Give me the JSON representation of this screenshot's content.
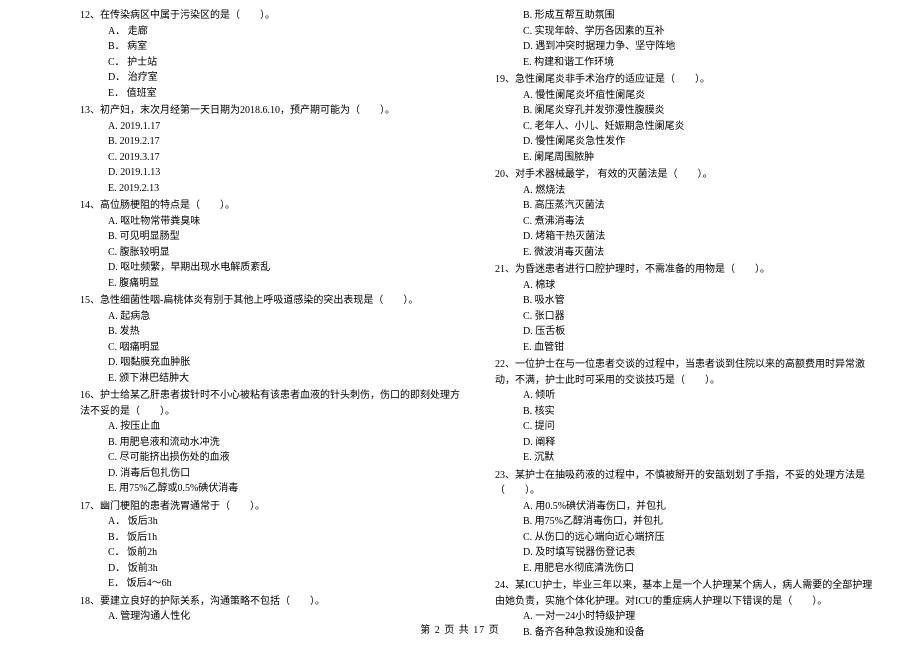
{
  "footer": "第 2 页 共 17 页",
  "left": [
    {
      "num": "12",
      "stem": "12、在传染病区中属于污染区的是（　　）。",
      "opts": [
        "A． 走廊",
        "B． 病室",
        "C． 护士站",
        "D． 治疗室",
        "E． 值班室"
      ]
    },
    {
      "num": "13",
      "stem": "13、初产妇，末次月经第一天日期为2018.6.10，预产期可能为（　　）。",
      "opts": [
        "A. 2019.1.17",
        "B. 2019.2.17",
        "C. 2019.3.17",
        "D. 2019.1.13",
        "E. 2019.2.13"
      ]
    },
    {
      "num": "14",
      "stem": "14、高位肠梗阻的特点是（　　）。",
      "opts": [
        "A. 呕吐物常带粪臭味",
        "B. 可见明显肠型",
        "C. 腹胀较明显",
        "D. 呕吐频繁，早期出现水电解质紊乱",
        "E. 腹痛明显"
      ]
    },
    {
      "num": "15",
      "stem": "15、急性细菌性咽-扁桃体炎有别于其他上呼吸道感染的突出表现是（　　）。",
      "opts": [
        "A. 起病急",
        "B. 发热",
        "C. 咽痛明显",
        "D. 咽黏膜充血肿胀",
        "E. 颁下淋巴结肿大"
      ]
    },
    {
      "num": "16",
      "stem": "16、护士给某乙肝患者拔针时不小心被粘有该患者血液的针头刺伤，伤口的即刻处理方法不妥的是（　　）。",
      "opts": [
        "A. 按压止血",
        "B. 用肥皂液和流动水冲洗",
        "C. 尽可能挤出损伤处的血液",
        "D. 消毒后包扎伤口",
        "E. 用75%乙醇或0.5%碘伏消毒"
      ]
    },
    {
      "num": "17",
      "stem": "17、幽门梗阻的患者洗胃通常于（　　）。",
      "opts": [
        "A． 饭后3h",
        "B． 饭后1h",
        "C． 饭前2h",
        "D． 饭前3h",
        "E． 饭后4～6h"
      ]
    },
    {
      "num": "18",
      "stem": "18、要建立良好的护际关系，沟通策略不包括（　　）。",
      "opts": [
        "A. 管理沟通人性化"
      ]
    }
  ],
  "right_pre": [
    "B. 形成互帮互助氛围",
    "C. 实现年龄、学历各因素的互补",
    "D. 遇到冲突时据理力争、坚守阵地",
    "E. 构建和谐工作环境"
  ],
  "right": [
    {
      "num": "19",
      "stem": "19、急性阑尾炎非手术治疗的适应证是（　　）。",
      "opts": [
        "A. 慢性阑尾炎坏疽性阑尾炎",
        "B. 阑尾炎穿孔并发弥漫性腹膜炎",
        "C. 老年人、小儿、妊娠期急性阑尾炎",
        "D. 慢性阑尾炎急性发作",
        "E. 阑尾周围脓肿"
      ]
    },
    {
      "num": "20",
      "stem": "20、对手术器械最学， 有效的灭菌法是（　　）。",
      "opts": [
        "A. 燃烧法",
        "B. 高压蒸汽灭菌法",
        "C. 煮沸消毒法",
        "D. 烤箱干热灭菌法",
        "E. 微波消毒灭菌法"
      ]
    },
    {
      "num": "21",
      "stem": "21、为昏迷患者进行口腔护理时，不需准备的用物是（　　）。",
      "opts": [
        "A. 棉球",
        "B. 吸水管",
        "C. 张口器",
        "D. 压舌板",
        "E. 血管钳"
      ]
    },
    {
      "num": "22",
      "stem": "22、一位护士在与一位患者交谈的过程中，当患者谈到住院以来的高额费用时异常激动，不满，护士此时可采用的交谈技巧是（　　）。",
      "opts": [
        "A. 倾听",
        "B. 核实",
        "C. 提问",
        "D. 阐释",
        "E. 沉默"
      ]
    },
    {
      "num": "23",
      "stem": "23、某护士在抽吸药液的过程中，不慎被掰开的安瓿划划了手指，不妥的处理方法是（　　）。",
      "opts": [
        "A. 用0.5%碘伏消毒伤口，并包扎",
        "B. 用75%乙醇消毒伤口，并包扎",
        "C. 从伤口的远心端向近心端挤压",
        "D. 及时填写锐器伤登记表",
        "E. 用肥皂水彻底清洗伤口"
      ]
    },
    {
      "num": "24",
      "stem": "24、某ICU护士，毕业三年以来，基本上是一个人护理某个病人，病人需要的全部护理由她负责，实施个体化护理。对ICU的重症病人护理以下错误的是（　　）。",
      "opts": [
        "A. 一对一24小时特级护理",
        "B. 备齐各种急救设施和设备"
      ]
    }
  ]
}
